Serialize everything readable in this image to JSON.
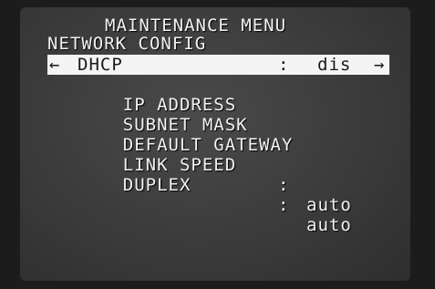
{
  "title": "MAINTENANCE MENU",
  "section": "NETWORK CONFIG",
  "selected_item": {
    "left_arrow": "←",
    "label": "DHCP",
    "colon": ":",
    "value": "dis",
    "right_arrow": "→"
  },
  "items": [
    {
      "label": "IP ADDRESS"
    },
    {
      "label": "SUBNET MASK"
    },
    {
      "label": "DEFAULT GATEWAY"
    },
    {
      "label": "LINK SPEED",
      "colon": ":",
      "value": "auto"
    },
    {
      "label": "DUPLEX",
      "colon": ":",
      "value": "auto"
    }
  ]
}
